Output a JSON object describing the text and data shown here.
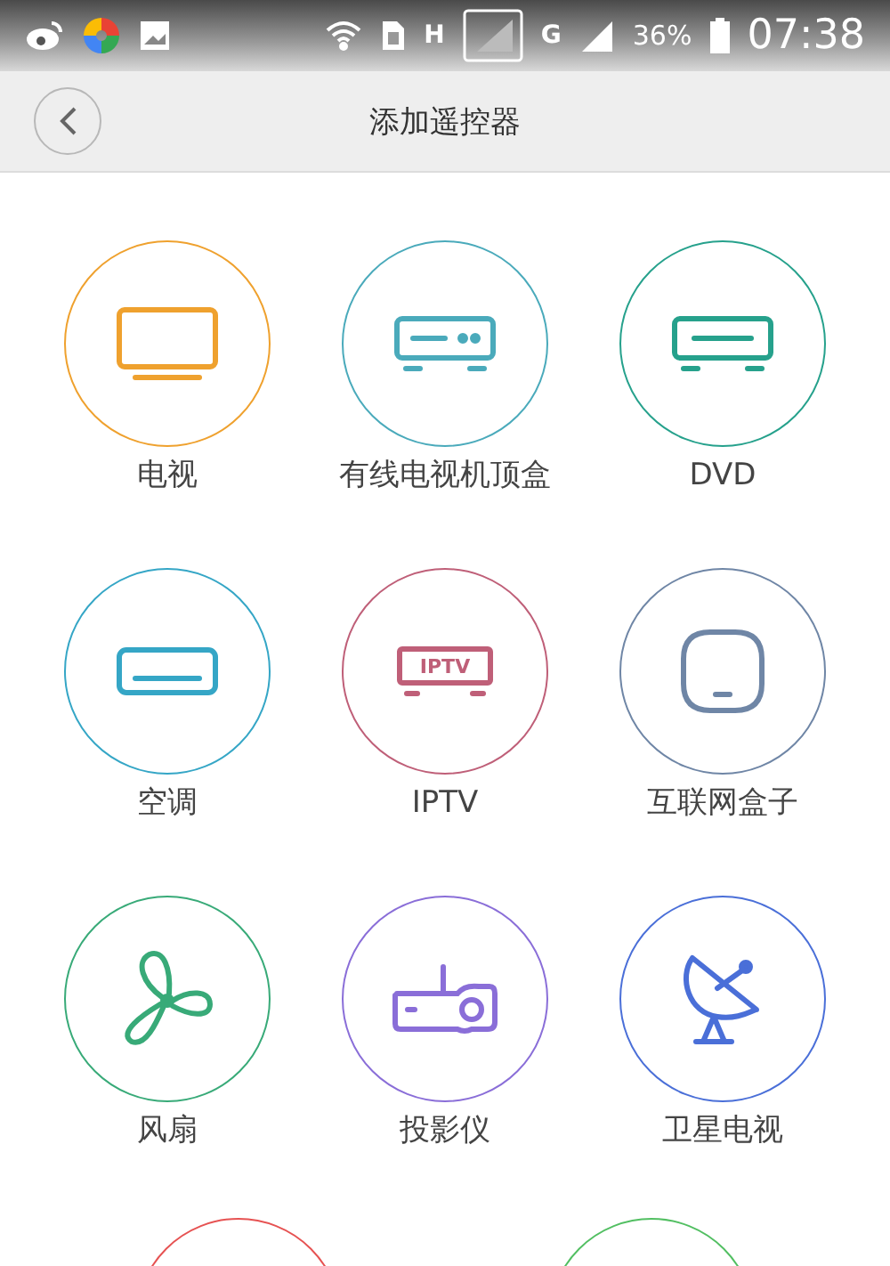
{
  "status_bar": {
    "network_1": "H",
    "network_2": "G",
    "battery": "36%",
    "time": "07:38"
  },
  "header": {
    "title": "添加遥控器"
  },
  "devices": [
    {
      "kind": "tv",
      "label": "电视",
      "color": "#efa12e"
    },
    {
      "kind": "settop",
      "label": "有线电视机顶盒",
      "color": "#4aaabb"
    },
    {
      "kind": "dvd",
      "label": "DVD",
      "color": "#26a18c"
    },
    {
      "kind": "ac",
      "label": "空调",
      "color": "#35a6c6"
    },
    {
      "kind": "iptv",
      "label": "IPTV",
      "color": "#bf5f78"
    },
    {
      "kind": "box",
      "label": "互联网盒子",
      "color": "#6f86a6"
    },
    {
      "kind": "fan",
      "label": "风扇",
      "color": "#38aa78"
    },
    {
      "kind": "projector",
      "label": "投影仪",
      "color": "#8a6ed8"
    },
    {
      "kind": "satellite",
      "label": "卫星电视",
      "color": "#4a6fd8"
    }
  ],
  "iptv_icon": {
    "text": "IPTV"
  },
  "partial_row": [
    {
      "color": "#e65252"
    },
    {
      "color": "#52bf62"
    }
  ]
}
